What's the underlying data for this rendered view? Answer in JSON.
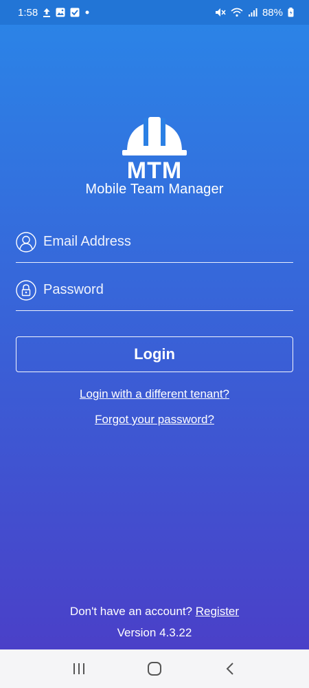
{
  "status_bar": {
    "time": "1:58",
    "battery": "88%",
    "icons_left": [
      "upload-icon",
      "image-icon",
      "checkbox-icon",
      "dot-icon"
    ],
    "icons_right": [
      "mute-icon",
      "wifi-icon",
      "signal-icon",
      "battery-icon"
    ]
  },
  "logo": {
    "text": "MTM"
  },
  "app_name": "Mobile Team Manager",
  "email": {
    "placeholder": "Email Address",
    "value": ""
  },
  "password": {
    "placeholder": "Password",
    "value": ""
  },
  "login_label": "Login",
  "links": {
    "tenant": "Login with a different tenant?",
    "forgot": "Forgot your password?"
  },
  "register": {
    "prompt": "Don't have an account?",
    "link": "Register"
  },
  "version": "Version 4.3.22",
  "colors": {
    "gradient_top": "#2a86e8",
    "gradient_bottom": "#4a40c8",
    "nav_bar": "#f5f5f7"
  }
}
